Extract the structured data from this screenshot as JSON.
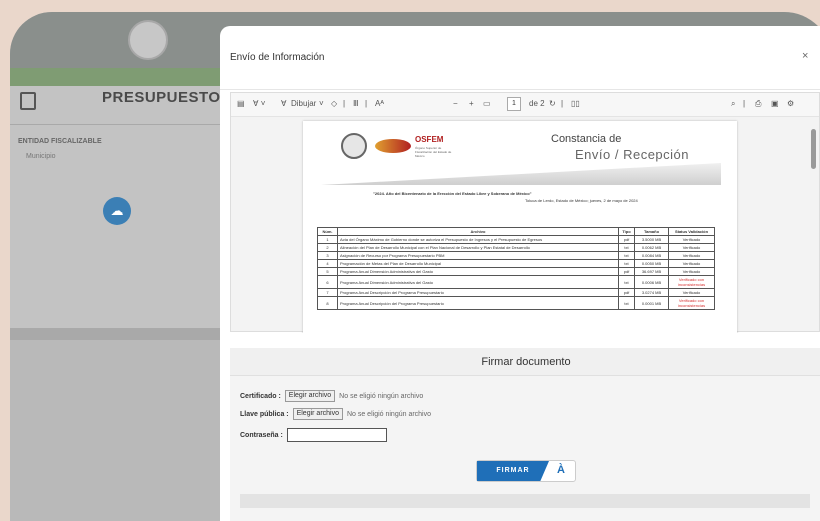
{
  "background": {
    "page_title": "PRESUPUESTO",
    "entity_label": "ENTIDAD FISCALIZABLE",
    "entity_value": "Municipio"
  },
  "modal": {
    "title": "Envío de Información",
    "close_label": "×"
  },
  "toolbar": {
    "draw_label": "Dibujar",
    "page_number": "1",
    "page_total": "de 2"
  },
  "document": {
    "logo_name": "OSFEM",
    "logo_tagline": "Órgano Superior de Fiscalización del Estado de México",
    "title_line1": "Constancia de",
    "title_line2": "Envío / Recepción",
    "slogan": "\"2024. Año del Bicentenario de la Erección del Estado Libre y Soberano de México\"",
    "date_line": "Toluca de Lerdo, Estado de México; jueves, 2 de mayo de 2024",
    "table": {
      "headers": [
        "Núm.",
        "Archivo",
        "Tipo",
        "Tamaño",
        "Status Validación"
      ],
      "rows": [
        {
          "num": "1",
          "archivo": "Acta del Órgano Máximo de Gobierno donde se autoriza el Presupuesto de Ingresos y el Presupuesto de Egresos",
          "tipo": "pdf",
          "tamano": "3.5000 MB",
          "status": "Verificado",
          "warn": false
        },
        {
          "num": "2",
          "archivo": "Alineación del Plan de Desarrollo Municipal con el Plan Nacional de Desarrollo y Plan Estatal de Desarrollo",
          "tipo": "txt",
          "tamano": "0.0062 MB",
          "status": "Verificado",
          "warn": false
        },
        {
          "num": "3",
          "archivo": "Asignación de Recurso por Programa Presupuestario PBM",
          "tipo": "txt",
          "tamano": "0.0084 MB",
          "status": "Verificado",
          "warn": false
        },
        {
          "num": "4",
          "archivo": "Programación de Metas del Plan de Desarrollo Municipal",
          "tipo": "txt",
          "tamano": "0.0050 MB",
          "status": "Verificado",
          "warn": false
        },
        {
          "num": "5",
          "archivo": "Programa Anual Dimensión Administrativa del Gasto",
          "tipo": "pdf",
          "tamano": "36.697 MB",
          "status": "Verificado",
          "warn": false
        },
        {
          "num": "6",
          "archivo": "Programa Anual Dimensión Administrativa del Gasto",
          "tipo": "txt",
          "tamano": "0.0006 MB",
          "status": "Verificado con inconsistencias",
          "warn": true
        },
        {
          "num": "7",
          "archivo": "Programa Anual Descripción del Programa Presupuestario",
          "tipo": "pdf",
          "tamano": "3.0274 MB",
          "status": "Verificado",
          "warn": false
        },
        {
          "num": "8",
          "archivo": "Programa Anual Descripción del Programa Presupuestario",
          "tipo": "txt",
          "tamano": "0.0001 MB",
          "status": "Verificado con inconsistencias",
          "warn": true
        }
      ]
    }
  },
  "sign": {
    "title": "Firmar documento",
    "certificado_label": "Certificado :",
    "llave_label": "Llave pública :",
    "contrasena_label": "Contraseña :",
    "choose_file_label": "Elegir archivo",
    "no_file_text": "No se eligió ningún archivo",
    "submit_label": "FIRMAR",
    "submit_icon": "À"
  },
  "colors": {
    "primary_blue": "#1f6fb8",
    "warning_red": "#d63030",
    "osfem_red": "#b12020"
  }
}
